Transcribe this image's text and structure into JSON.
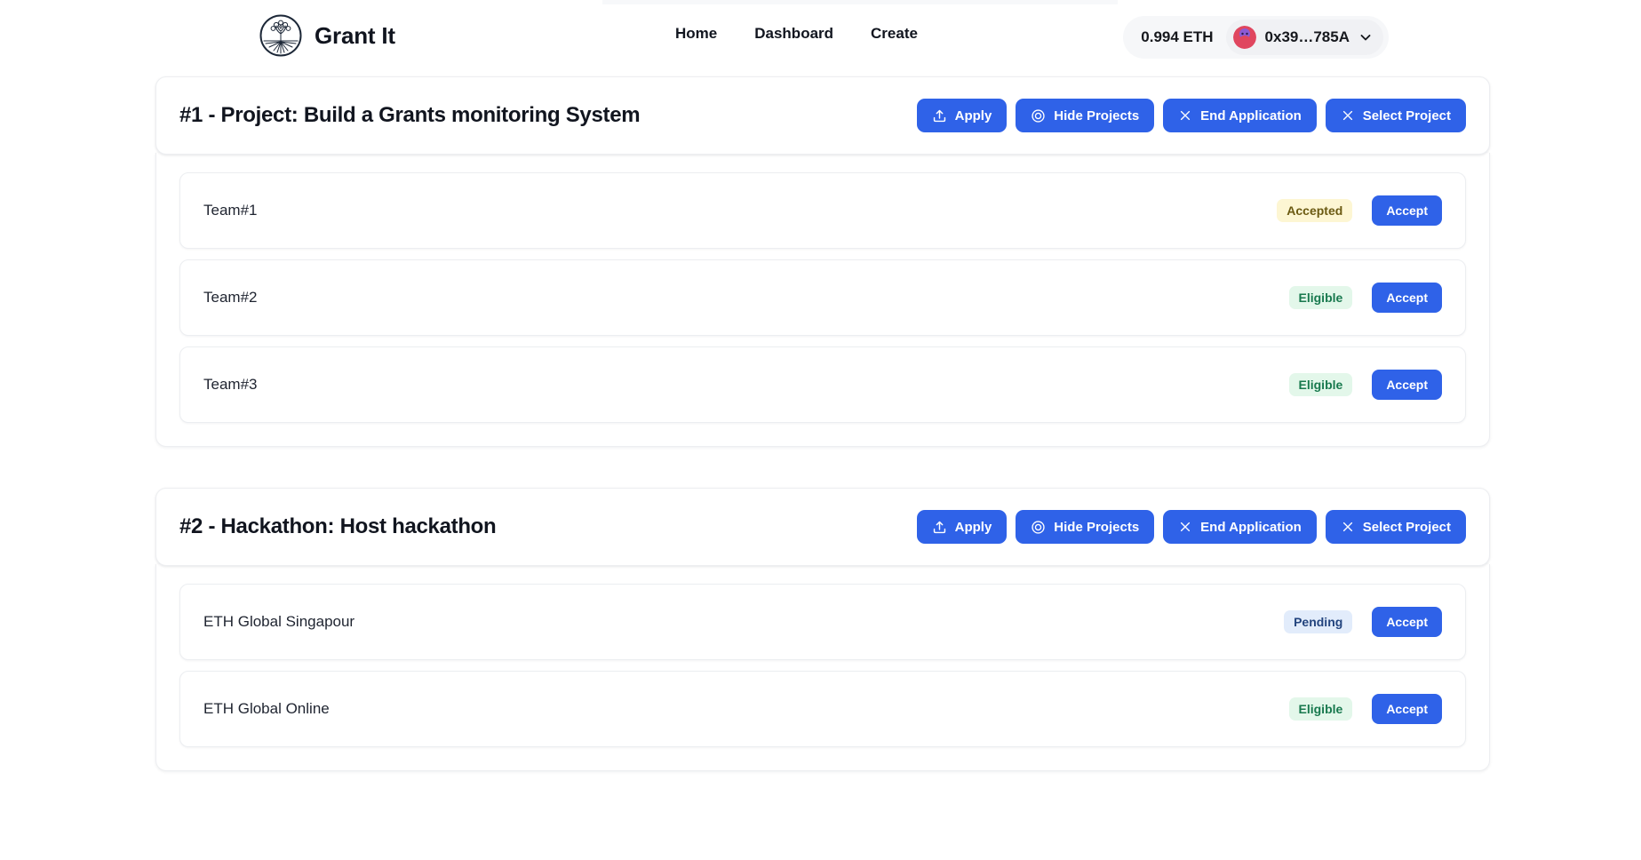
{
  "header": {
    "brand_name": "Grant It",
    "logo_icon": "tree-circle-logo",
    "nav": [
      {
        "label": "Home",
        "name": "home"
      },
      {
        "label": "Dashboard",
        "name": "dashboard"
      },
      {
        "label": "Create",
        "name": "create"
      }
    ],
    "wallet": {
      "balance": "0.994 ETH",
      "address": "0x39…785A",
      "avatar_icon": "wallet-avatar",
      "chevron_icon": "chevron-down-icon"
    }
  },
  "sections": [
    {
      "title": "#1 - Project: Build a Grants monitoring System",
      "actions": [
        {
          "label": "Apply",
          "icon": "upload-icon",
          "name": "apply-button"
        },
        {
          "label": "Hide Projects",
          "icon": "eye-circle-icon",
          "name": "hide-projects-button"
        },
        {
          "label": "End Application",
          "icon": "close-x-icon",
          "name": "end-application-button"
        },
        {
          "label": "Select Project",
          "icon": "close-x-icon",
          "name": "select-project-button"
        }
      ],
      "rows": [
        {
          "title": "Team#1",
          "status": "Accepted",
          "status_kind": "accepted",
          "action_label": "Accept"
        },
        {
          "title": "Team#2",
          "status": "Eligible",
          "status_kind": "eligible",
          "action_label": "Accept"
        },
        {
          "title": "Team#3",
          "status": "Eligible",
          "status_kind": "eligible",
          "action_label": "Accept"
        }
      ]
    },
    {
      "title": "#2 - Hackathon: Host hackathon",
      "actions": [
        {
          "label": "Apply",
          "icon": "upload-icon",
          "name": "apply-button"
        },
        {
          "label": "Hide Projects",
          "icon": "eye-circle-icon",
          "name": "hide-projects-button"
        },
        {
          "label": "End Application",
          "icon": "close-x-icon",
          "name": "end-application-button"
        },
        {
          "label": "Select Project",
          "icon": "close-x-icon",
          "name": "select-project-button"
        }
      ],
      "rows": [
        {
          "title": "ETH Global Singapour",
          "status": "Pending",
          "status_kind": "pending",
          "action_label": "Accept"
        },
        {
          "title": "ETH Global Online",
          "status": "Eligible",
          "status_kind": "eligible",
          "action_label": "Accept"
        }
      ]
    }
  ],
  "colors": {
    "primary_blue": "#2f62e8",
    "text_dark": "#11151f",
    "page_background": "#ffffff",
    "badge_accepted_bg": "#fdf6d3",
    "badge_eligible_bg": "#e3f7ea",
    "badge_pending_bg": "#e2ecfb"
  }
}
